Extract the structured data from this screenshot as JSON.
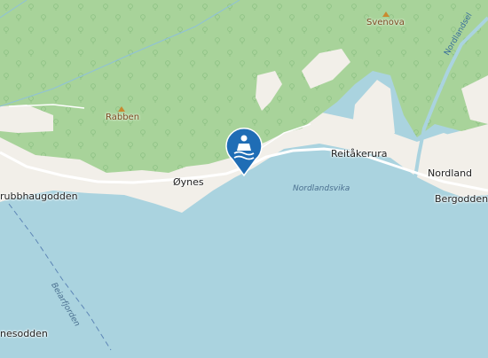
{
  "colors": {
    "water": "#aad3df",
    "forest": "#a8d39a",
    "land": "#f2efe9",
    "road": "#ffffff",
    "stream": "#8fc1d8",
    "marker": "#1f6db5"
  },
  "labels": {
    "rabben": "Rabben",
    "svenova": "Svenova",
    "nordlandselva": "Nordlandsel",
    "reitakerura": "Reitåkerura",
    "nordland": "Nordland",
    "bergodden": "Bergodden",
    "oynes": "Øynes",
    "stubbhaugodden": "rubbhaugodden",
    "nordlandsvika": "Nordlandsvika",
    "beiarfjorden": "Beiarfjorden",
    "nesodden": "nesodden"
  },
  "marker": {
    "icon": "swimming-icon",
    "type": "bathing place"
  }
}
